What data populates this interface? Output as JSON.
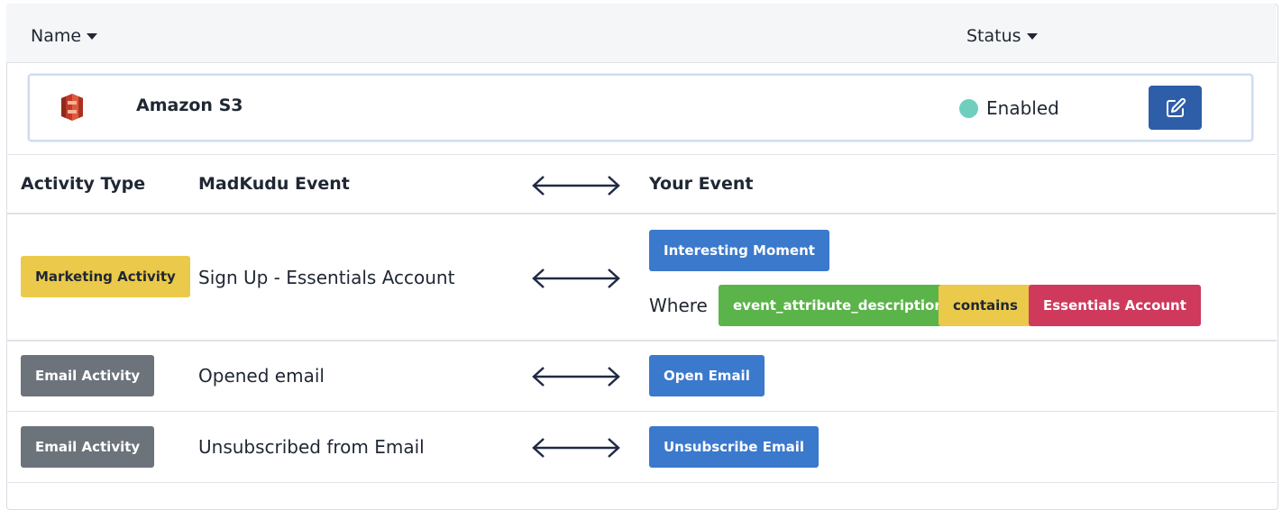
{
  "list_header": {
    "name_label": "Name",
    "status_label": "Status"
  },
  "integration": {
    "name": "Amazon S3",
    "icon": "amazon-s3-logo",
    "status": "Enabled",
    "status_color": "#6fcfbf",
    "edit_icon": "edit-icon"
  },
  "mapping_table": {
    "headers": {
      "activity_type": "Activity Type",
      "madkudu_event": "MadKudu Event",
      "your_event": "Your Event"
    },
    "rows": [
      {
        "activity_type": "Marketing Activity",
        "madkudu_event": "Sign Up - Essentials Account",
        "your_event": "Interesting Moment",
        "where_label": "Where",
        "condition": {
          "attribute": "event_attribute_description",
          "operator": "contains",
          "value": "Essentials Account"
        }
      },
      {
        "activity_type": "Email Activity",
        "madkudu_event": "Opened email",
        "your_event": "Open Email"
      },
      {
        "activity_type": "Email Activity",
        "madkudu_event": "Unsubscribed from Email",
        "your_event": "Unsubscribe Email"
      }
    ]
  },
  "colors": {
    "primary_button": "#2f5ea8",
    "event_badge": "#3b79cc",
    "marketing_badge": "#ebc94a",
    "email_badge": "#6c737b",
    "attribute_badge": "#5bb449",
    "value_badge": "#cf3a5c"
  }
}
